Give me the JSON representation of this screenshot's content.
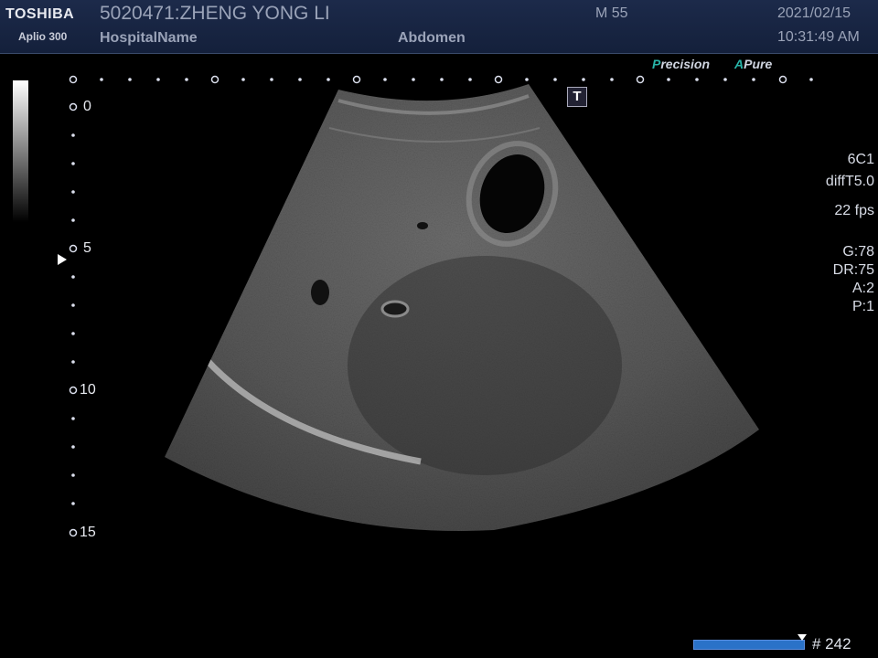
{
  "header": {
    "brand": "TOSHIBA",
    "model": "Aplio 300",
    "patient": "5020471:ZHENG YONG LI",
    "hospital": "HospitalName",
    "exam": "Abdomen",
    "sex_age": "M 55",
    "date": "2021/02/15",
    "time": "10:31:49 AM"
  },
  "modes": {
    "precision_prefix": "P",
    "precision_rest": "recision",
    "apure_prefix": "A",
    "apure_rest": "Pure"
  },
  "params": {
    "probe": "6C1",
    "preset": "diffT5.0",
    "fps": "22 fps",
    "gain": "G:78",
    "dynamic_range": "DR:75",
    "a": "A:2",
    "p": "P:1"
  },
  "depth_scale": [
    "0",
    "5",
    "10",
    "15"
  ],
  "depth_unit_icon": "T",
  "frame_counter": "# 242",
  "colors": {
    "header_bg": "#1c2a4a",
    "accent_teal": "#28b4a8",
    "frame_bar": "#2a72c8"
  },
  "image": {
    "description_icon": "ultrasound-liver-icon"
  }
}
